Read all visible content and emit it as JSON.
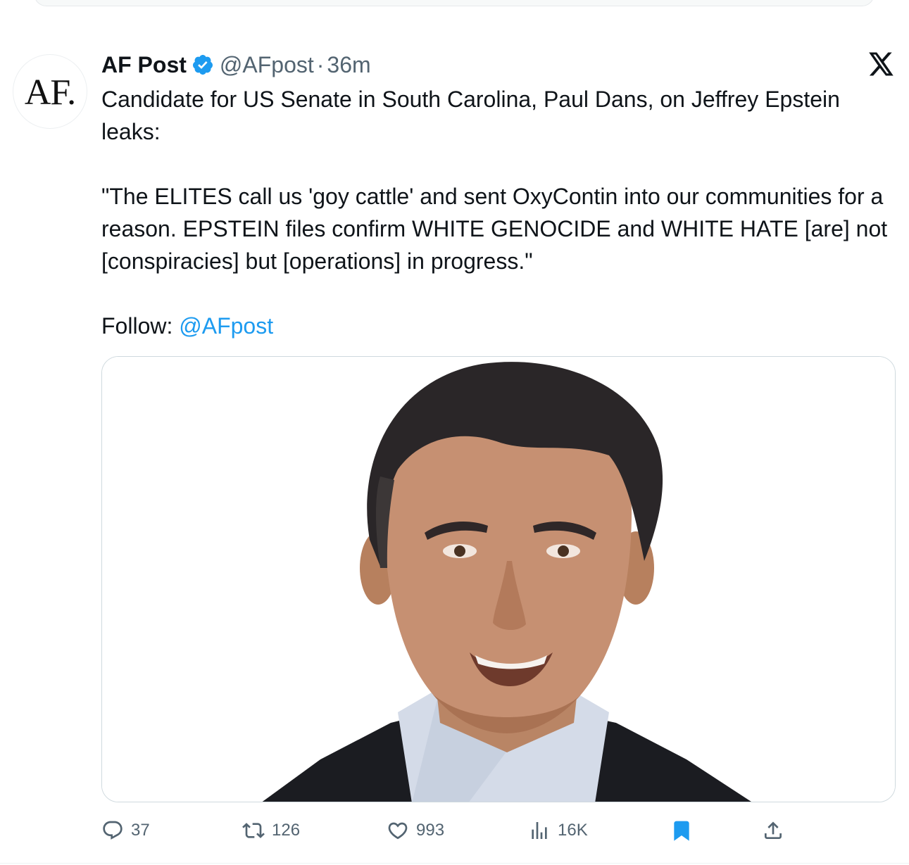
{
  "tweet": {
    "avatar_text": "AF.",
    "author_name": "AF Post",
    "handle": "@AFpost",
    "separator": "·",
    "time": "36m",
    "text": {
      "line1": "Candidate for US Senate in South Carolina, Paul Dans, on Jeffrey Epstein leaks:",
      "quote": "\"The ELITES call us 'goy cattle' and sent OxyContin into our communities for a reason. EPSTEIN files confirm WHITE GENOCIDE and WHITE HATE [are] not [conspiracies] but [operations] in progress.\"",
      "follow_label": "Follow: ",
      "follow_mention": "@AFpost"
    }
  },
  "actions": {
    "replies": "37",
    "reposts": "126",
    "likes": "993",
    "views": "16K"
  },
  "icons": {
    "verified": "verified-badge-icon",
    "platform": "x-logo-icon",
    "reply": "reply-icon",
    "repost": "repost-icon",
    "like": "heart-icon",
    "views": "views-icon",
    "bookmark": "bookmark-icon",
    "share": "share-icon"
  },
  "colors": {
    "accent": "#1d9bf0",
    "muted": "#536471",
    "text": "#0f1419",
    "bookmark_active": "#1d9bf0"
  }
}
